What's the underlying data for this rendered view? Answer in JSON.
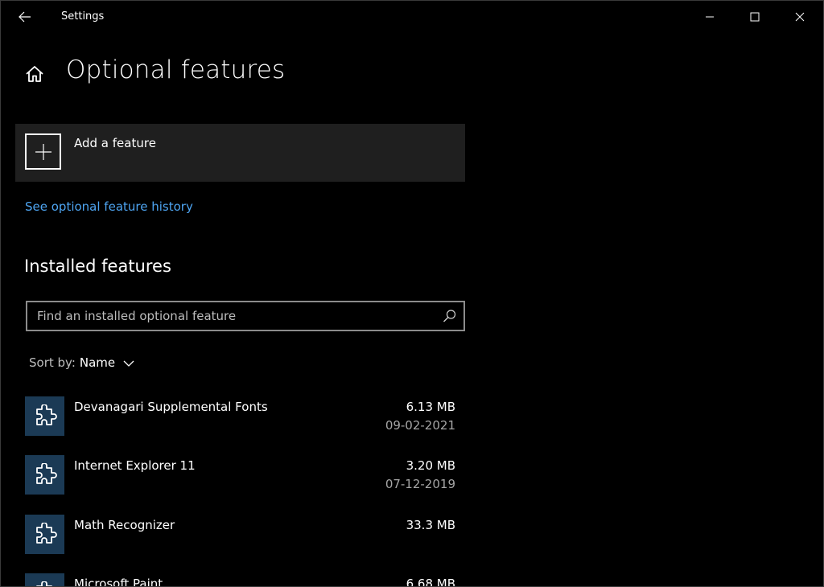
{
  "window": {
    "app_title": "Settings"
  },
  "header": {
    "page_title": "Optional features"
  },
  "add_feature": {
    "label": "Add a feature"
  },
  "history_link": "See optional feature history",
  "installed": {
    "section_title": "Installed features",
    "search_placeholder": "Find an installed optional feature",
    "search_value": "",
    "sort_label": "Sort by:",
    "sort_value": "Name",
    "items": [
      {
        "name": "Devanagari Supplemental Fonts",
        "size": "6.13 MB",
        "date": "09-02-2021"
      },
      {
        "name": "Internet Explorer 11",
        "size": "3.20 MB",
        "date": "07-12-2019"
      },
      {
        "name": "Math Recognizer",
        "size": "33.3 MB",
        "date": ""
      },
      {
        "name": "Microsoft Paint",
        "size": "6.68 MB",
        "date": ""
      }
    ]
  },
  "icons": {
    "back": "back-arrow-icon",
    "home": "home-icon",
    "plus": "plus-icon",
    "search": "search-icon",
    "chevron": "chevron-down-icon",
    "feature": "puzzle-piece-icon",
    "minimize": "minimize-icon",
    "maximize": "maximize-icon",
    "close": "close-icon"
  },
  "colors": {
    "background": "#000000",
    "tile": "#1f1f1f",
    "accent_link": "#4ea5f2",
    "feature_icon_bg": "#1b3a55",
    "secondary_text": "#a6a6a6"
  }
}
